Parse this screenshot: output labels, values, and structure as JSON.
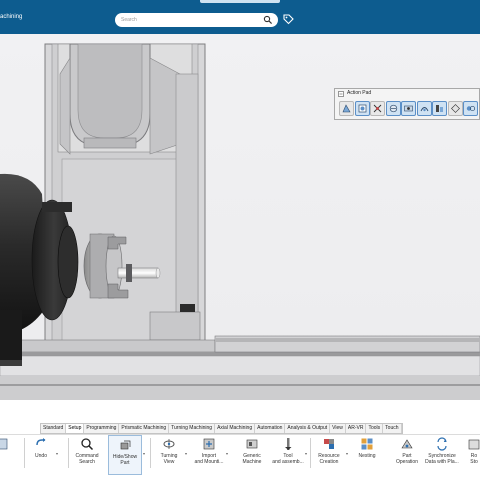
{
  "header": {
    "app_title": "achining",
    "search_placeholder": "Search"
  },
  "action_pad": {
    "title": "Action Pad",
    "buttons": [
      {
        "name": "icon-1",
        "active": false
      },
      {
        "name": "icon-2",
        "active": true
      },
      {
        "name": "icon-3",
        "active": false
      },
      {
        "name": "icon-4",
        "active": true
      },
      {
        "name": "icon-5",
        "active": true
      },
      {
        "name": "icon-6",
        "active": true
      },
      {
        "name": "icon-7",
        "active": true
      },
      {
        "name": "icon-8",
        "active": false
      },
      {
        "name": "icon-9",
        "active": true
      }
    ]
  },
  "tabs": [
    {
      "label": "Standard"
    },
    {
      "label": "Setup"
    },
    {
      "label": "Programming"
    },
    {
      "label": "Prismatic Machining"
    },
    {
      "label": "Turning Machining"
    },
    {
      "label": "Axial Machining"
    },
    {
      "label": "Automation"
    },
    {
      "label": "Analysis & Output"
    },
    {
      "label": "View"
    },
    {
      "label": "AR-VR"
    },
    {
      "label": "Tools"
    },
    {
      "label": "Touch"
    }
  ],
  "active_tab": "Setup",
  "tools": [
    {
      "label": "Undo"
    },
    {
      "label": "Command\nSearch"
    },
    {
      "label": "Hide/Show\nPart"
    },
    {
      "label": "Turning\nView"
    },
    {
      "label": "Import\nand Mounti..."
    },
    {
      "label": "Generic\nMachine"
    },
    {
      "label": "Tool\nand assemb..."
    },
    {
      "label": "Resource\nCreation"
    },
    {
      "label": "Nesting"
    },
    {
      "label": "Part\nOperation"
    },
    {
      "label": "Synchronize\nData with Pla..."
    },
    {
      "label": "Ro\nSto"
    }
  ]
}
